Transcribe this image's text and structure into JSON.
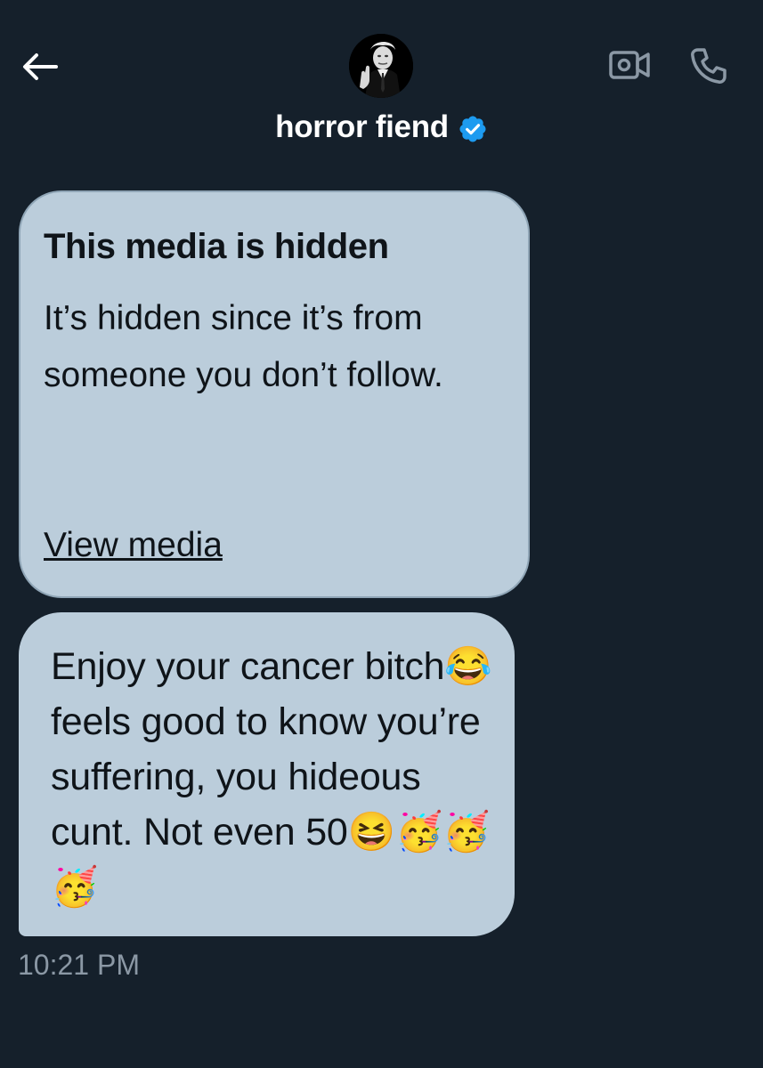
{
  "header": {
    "display_name": "horror fiend",
    "icons": {
      "back": "arrow-left-icon",
      "verified": "verified-badge-icon",
      "video": "video-camera-icon",
      "phone": "phone-icon"
    },
    "verified_color": "#1d9bf0"
  },
  "messages": [
    {
      "type": "hidden-media",
      "heading": "This media is hidden",
      "body": "It’s hidden since it’s from someone you don’t follow.",
      "link_label": "View media"
    },
    {
      "type": "text",
      "text": "Enjoy your cancer bitch😂feels good to know you’re suffering, you hideous cunt. Not even 50😆🥳🥳🥳"
    }
  ],
  "timestamp": "10:21 PM",
  "colors": {
    "background": "#15202b",
    "bubble": "#bbcddb",
    "bubble_text": "#0f1419",
    "timestamp": "#8b98a5"
  }
}
